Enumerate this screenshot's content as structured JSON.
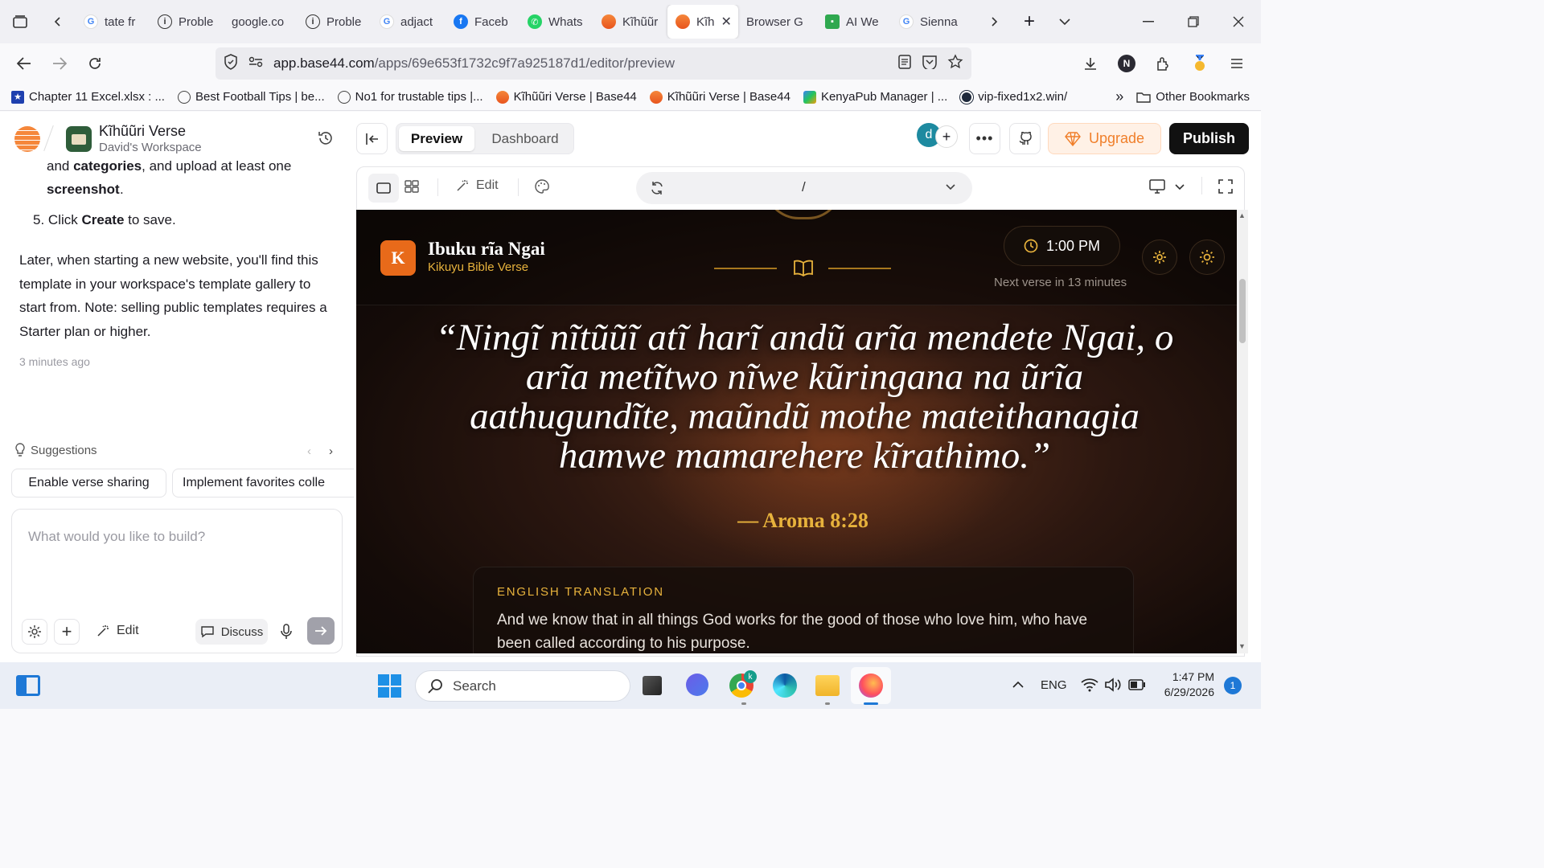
{
  "browser": {
    "tabs": [
      {
        "label": "tate fr",
        "icon": "google-icon"
      },
      {
        "label": "Proble",
        "icon": "info-icon"
      },
      {
        "label": "google.co",
        "icon": ""
      },
      {
        "label": "Proble",
        "icon": "info-icon"
      },
      {
        "label": "adjact",
        "icon": "google-icon"
      },
      {
        "label": "Faceb",
        "icon": "facebook-icon"
      },
      {
        "label": "Whats",
        "icon": "whatsapp-icon"
      },
      {
        "label": "Kĩhũũr",
        "icon": "base44-icon"
      },
      {
        "label": "Kĩh",
        "icon": "base44-icon",
        "active": true
      },
      {
        "label": "Browser G",
        "icon": ""
      },
      {
        "label": "AI We",
        "icon": "android-icon"
      },
      {
        "label": "Sienna",
        "icon": "google-icon"
      }
    ],
    "url_domain": "app.base44.com",
    "url_path": "/apps/69e653f1732c9f7a925187d1/editor/preview",
    "profile_initial": "N",
    "bookmarks": [
      {
        "label": "Chapter 11 Excel.xlsx : ...",
        "icon": "bookmark-star-icon"
      },
      {
        "label": "Best Football Tips | be...",
        "icon": "globe-icon"
      },
      {
        "label": "No1 for trustable tips |...",
        "icon": "globe-icon"
      },
      {
        "label": "Kĩhũũri Verse | Base44",
        "icon": "base44-icon"
      },
      {
        "label": "Kĩhũũri Verse | Base44",
        "icon": "base44-icon"
      },
      {
        "label": "KenyaPub Manager | ...",
        "icon": "kenyapub-icon"
      },
      {
        "label": "vip-fixed1x2.win/",
        "icon": "soccer-icon"
      }
    ],
    "other_bookmarks": "Other Bookmarks"
  },
  "sidebar": {
    "app_name": "Kĩhũũri Verse",
    "workspace": "David's Workspace",
    "chat": {
      "partial_line_a": "and ",
      "partial_bold_a": "categories",
      "partial_line_b": ", and upload at least one",
      "bold_screenshot": "screenshot",
      "step5_num": "5.",
      "step5_pre": "Click ",
      "step5_bold": "Create",
      "step5_post": " to save.",
      "paragraph": "Later, when starting a new website, you'll find this template in your workspace's template gallery to start from. Note: selling public templates requires a Starter plan or higher.",
      "timestamp": "3 minutes ago"
    },
    "suggestions_label": "Suggestions",
    "suggestions": [
      "Enable verse sharing",
      "Implement favorites colle"
    ],
    "input_placeholder": "What would you like to build?",
    "edit_label": "Edit",
    "discuss_label": "Discuss"
  },
  "editor": {
    "tab_preview": "Preview",
    "tab_dashboard": "Dashboard",
    "avatar_initial": "d",
    "upgrade_label": "Upgrade",
    "publish_label": "Publish",
    "edit_label": "Edit",
    "route": "/"
  },
  "site": {
    "logo_letter": "K",
    "title": "Ibuku rĩa Ngai",
    "subtitle": "Kikuyu Bible Verse",
    "time": "1:00 PM",
    "next_verse": "Next verse in 13 minutes",
    "verse": "“Ningĩ nĩtũũĩ atĩ harĩ andũ arĩa mendete Ngai, o arĩa metĩtwo nĩwe kũringana na ũrĩa aathugundĩte, maũndũ mothe mateithanagia hamwe mamarehere kĩrathimo.”",
    "reference": "— Aroma 8:28",
    "translation_label": "ENGLISH TRANSLATION",
    "translation": "And we know that in all things God works for the good of those who love him, who have been called according to his purpose."
  },
  "taskbar": {
    "search_placeholder": "Search",
    "language": "ENG",
    "time": "1:47 PM",
    "date": "6/29/2026",
    "notification_count": "1"
  },
  "colors": {
    "accent_orange": "#f07f2a",
    "gold": "#e7b23c",
    "publish_bg": "#111111",
    "upgrade_bg": "#fff1e6"
  }
}
